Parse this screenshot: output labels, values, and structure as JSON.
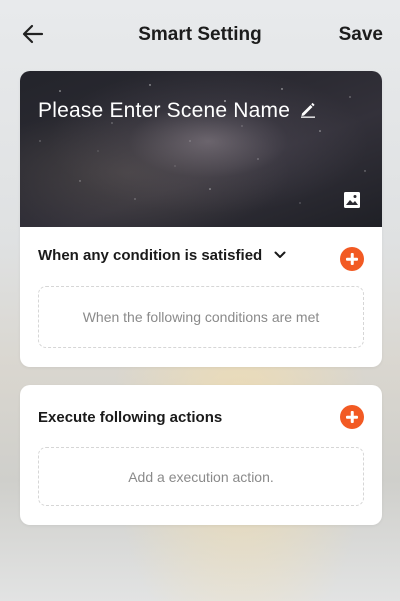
{
  "header": {
    "title": "Smart Setting",
    "save_label": "Save"
  },
  "scene": {
    "name_placeholder": "Please Enter Scene Name"
  },
  "conditions": {
    "heading": "When any condition is satisfied",
    "empty_text": "When the following conditions are met"
  },
  "actions": {
    "heading": "Execute following actions",
    "empty_text": "Add a execution action."
  },
  "colors": {
    "accent": "#f25a23",
    "banner_dark": "#23242b"
  },
  "icons": [
    "back-arrow-icon",
    "pencil-icon",
    "image-icon",
    "chevron-down-icon",
    "add-icon"
  ]
}
